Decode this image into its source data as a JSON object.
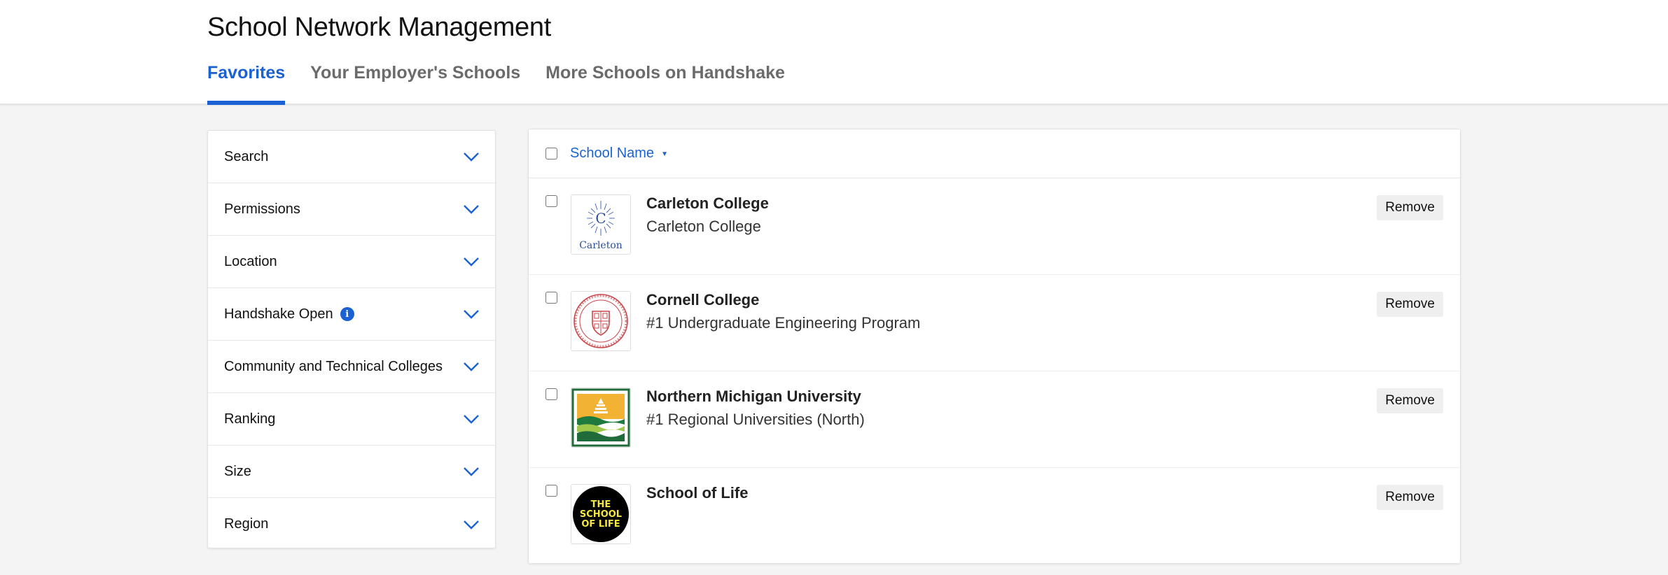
{
  "page": {
    "title": "School Network Management"
  },
  "tabs": [
    {
      "label": "Favorites",
      "active": true
    },
    {
      "label": "Your Employer's Schools",
      "active": false
    },
    {
      "label": "More Schools on Handshake",
      "active": false
    }
  ],
  "filters": [
    {
      "label": "Search"
    },
    {
      "label": "Permissions"
    },
    {
      "label": "Location"
    },
    {
      "label": "Handshake Open",
      "info_icon": "info-icon"
    },
    {
      "label": "Community and Technical Colleges"
    },
    {
      "label": "Ranking"
    },
    {
      "label": "Size"
    },
    {
      "label": "Region"
    }
  ],
  "list": {
    "sort_label": "School Name",
    "remove_label": "Remove",
    "schools": [
      {
        "name": "Carleton College",
        "subtitle": "Carleton College",
        "logo": "carleton-logo",
        "logo_text": "Carleton",
        "logo_letter": "C"
      },
      {
        "name": "Cornell College",
        "subtitle": "#1 Undergraduate Engineering Program",
        "logo": "cornell-seal"
      },
      {
        "name": "Northern Michigan University",
        "subtitle": "#1 Regional Universities (North)",
        "logo": "nmu-logo"
      },
      {
        "name": "School of Life",
        "subtitle": "",
        "logo": "school-of-life-logo",
        "logo_text": "THE SCHOOL OF LIFE"
      }
    ]
  },
  "colors": {
    "accent": "#1a62d4",
    "background": "#f4f4f4",
    "panel": "#ffffff"
  }
}
